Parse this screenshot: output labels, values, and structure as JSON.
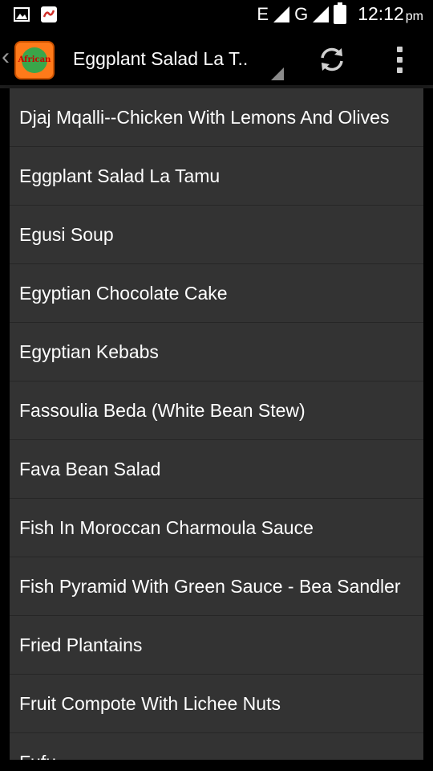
{
  "status_bar": {
    "network_1": "E",
    "network_2": "G",
    "time": "12:12",
    "time_suffix": "pm"
  },
  "action_bar": {
    "back_glyph": "‹",
    "app_icon_text": "African",
    "spinner_title": "Eggplant Salad La T..",
    "refresh_icon": "refresh-icon",
    "overflow_icon": "overflow-menu-icon"
  },
  "recipes": [
    "Djaj Mqalli--Chicken With Lemons And Olives",
    "Eggplant Salad La Tamu",
    "Egusi Soup",
    "Egyptian Chocolate Cake",
    "Egyptian Kebabs",
    "Fassoulia Beda (White Bean Stew)",
    "Fava Bean Salad",
    "Fish In Moroccan Charmoula Sauce",
    "Fish Pyramid With Green Sauce - Bea Sandler",
    "Fried Plantains",
    "Fruit Compote With Lichee Nuts",
    "Fufu"
  ],
  "colors": {
    "background": "#000000",
    "list_background": "#333333",
    "divider": "#262626",
    "text": "#ffffff",
    "icon_orange": "#ff7a1a"
  }
}
